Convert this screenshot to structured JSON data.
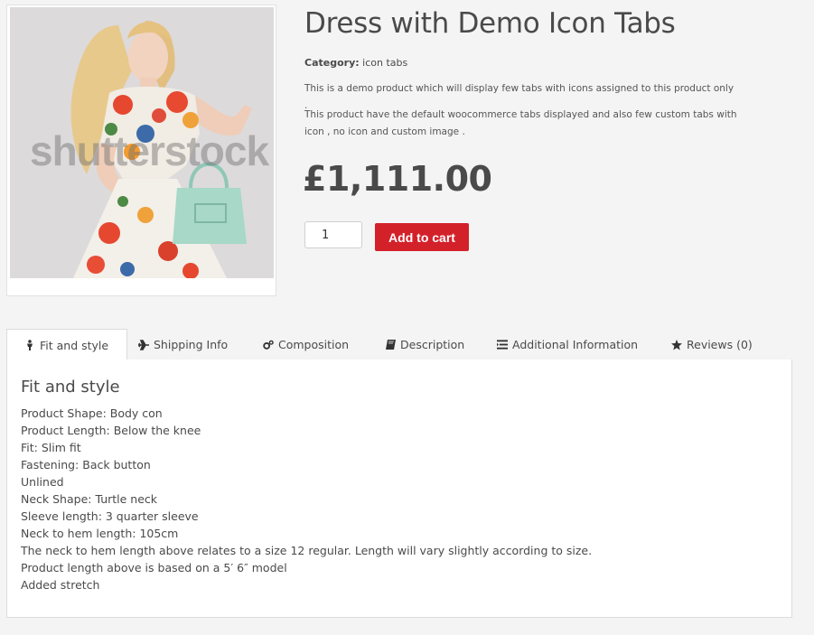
{
  "product": {
    "title": "Dress with Demo Icon Tabs",
    "category_label": "Category:",
    "category_value": "icon tabs",
    "description": [
      "This is a demo product which will display few tabs with icons assigned to this product only .",
      "This product have the default woocommerce tabs displayed and also few custom tabs with",
      "icon , no icon and custom image ."
    ],
    "price": "£1,111.00",
    "quantity": "1",
    "add_to_cart_label": "Add to cart",
    "image_watermark": "shutterstock"
  },
  "tabs": [
    {
      "label": "Fit and style",
      "icon": "person-icon",
      "active": true
    },
    {
      "label": "Shipping Info",
      "icon": "plane-icon",
      "active": false
    },
    {
      "label": "Composition",
      "icon": "gears-icon",
      "active": false
    },
    {
      "label": "Description",
      "icon": "book-icon",
      "active": false
    },
    {
      "label": "Additional Information",
      "icon": "list-icon",
      "active": false
    },
    {
      "label": "Reviews (0)",
      "icon": "star-icon",
      "active": false
    }
  ],
  "panel": {
    "title": "Fit and style",
    "lines": [
      "Product Shape: Body con",
      "Product Length: Below the knee",
      "Fit: Slim fit",
      "Fastening: Back button",
      "Unlined",
      "Neck Shape: Turtle neck",
      "Sleeve length: 3 quarter sleeve",
      "Neck to hem length: 105cm",
      "The neck to hem length above relates to a size 12 regular. Length will vary slightly according to size.",
      "Product length above is based on a 5′ 6″ model",
      "Added stretch"
    ]
  },
  "colors": {
    "accent": "#d3212a",
    "background": "#f4f4f4",
    "text": "#4a4a4a"
  }
}
